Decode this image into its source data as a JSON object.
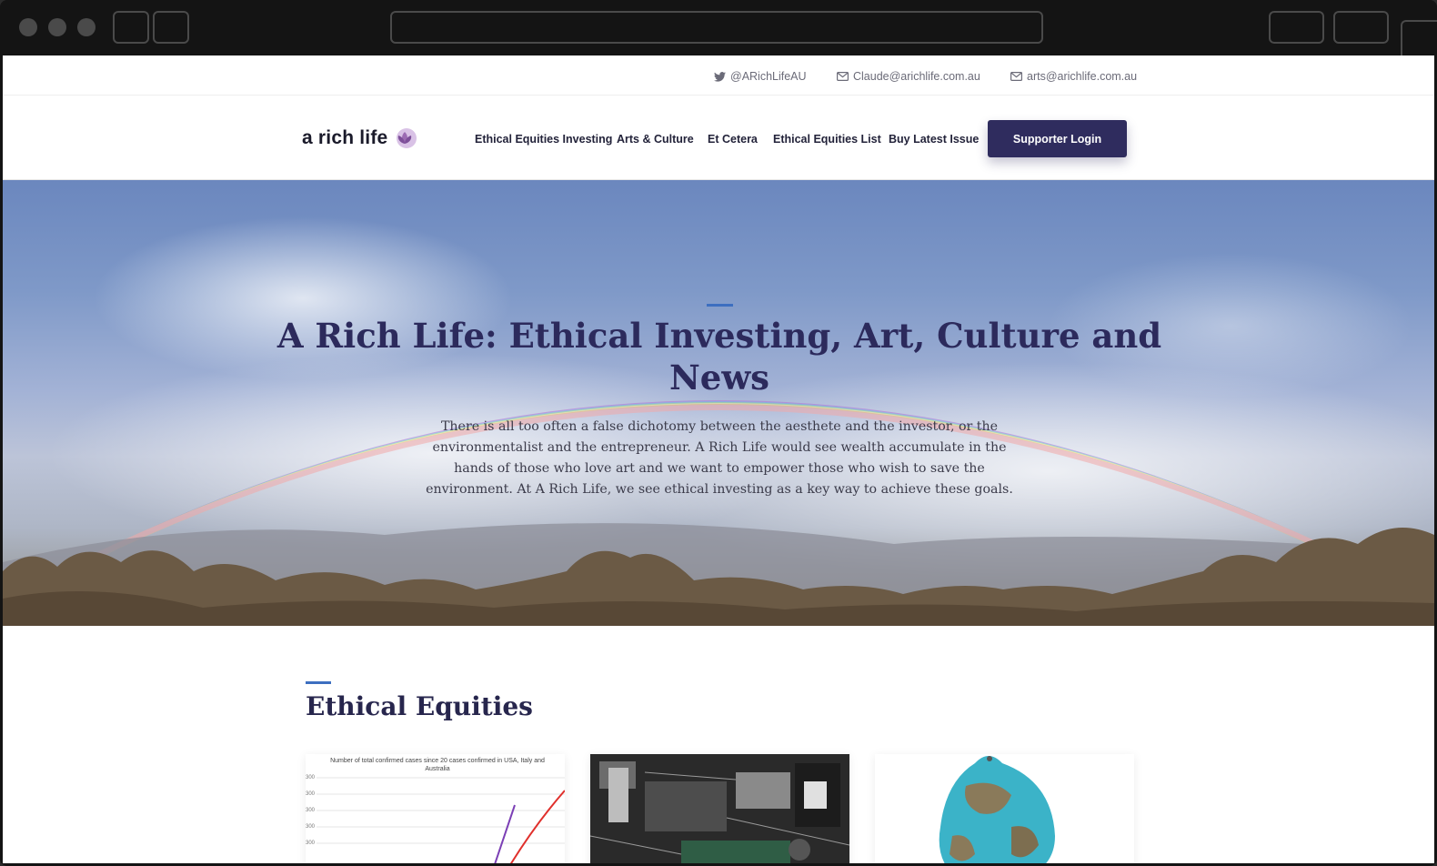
{
  "browser": {
    "icons": [
      "traffic-light",
      "back-button",
      "forward-button",
      "url-bar",
      "window-button"
    ]
  },
  "topbar": {
    "twitter": "@ARichLifeAU",
    "email1": "Claude@arichlife.com.au",
    "email2": "arts@arichlife.com.au"
  },
  "header": {
    "logo_text": "a rich life",
    "nav": [
      "Ethical Equities Investing",
      "Arts & Culture",
      "Et Cetera",
      "Ethical Equities List",
      "Buy Latest Issue"
    ],
    "login_label": "Supporter Login",
    "accent_color": "#2f2c5e"
  },
  "hero": {
    "title": "A Rich Life: Ethical Investing, Art, Culture and News",
    "text": "There is all too often a false dichotomy between the aesthete and the investor, or the environmentalist and the entrepreneur. A Rich Life would see wealth accumulate in the hands of those who love art and we want to empower those who wish to save the environment. At A Rich Life, we see ethical investing as a key way to achieve these goals."
  },
  "section": {
    "title": "Ethical Equities",
    "cards": [
      {
        "kind": "chart-thumbnail",
        "chart_title": "Number of total confirmed cases since 20 cases confirmed in USA, Italy and Australia",
        "ticks": [
          "300",
          "300",
          "300",
          "300",
          "300"
        ]
      },
      {
        "kind": "circuit-board-photo"
      },
      {
        "kind": "globe-pendant-photo"
      }
    ]
  }
}
